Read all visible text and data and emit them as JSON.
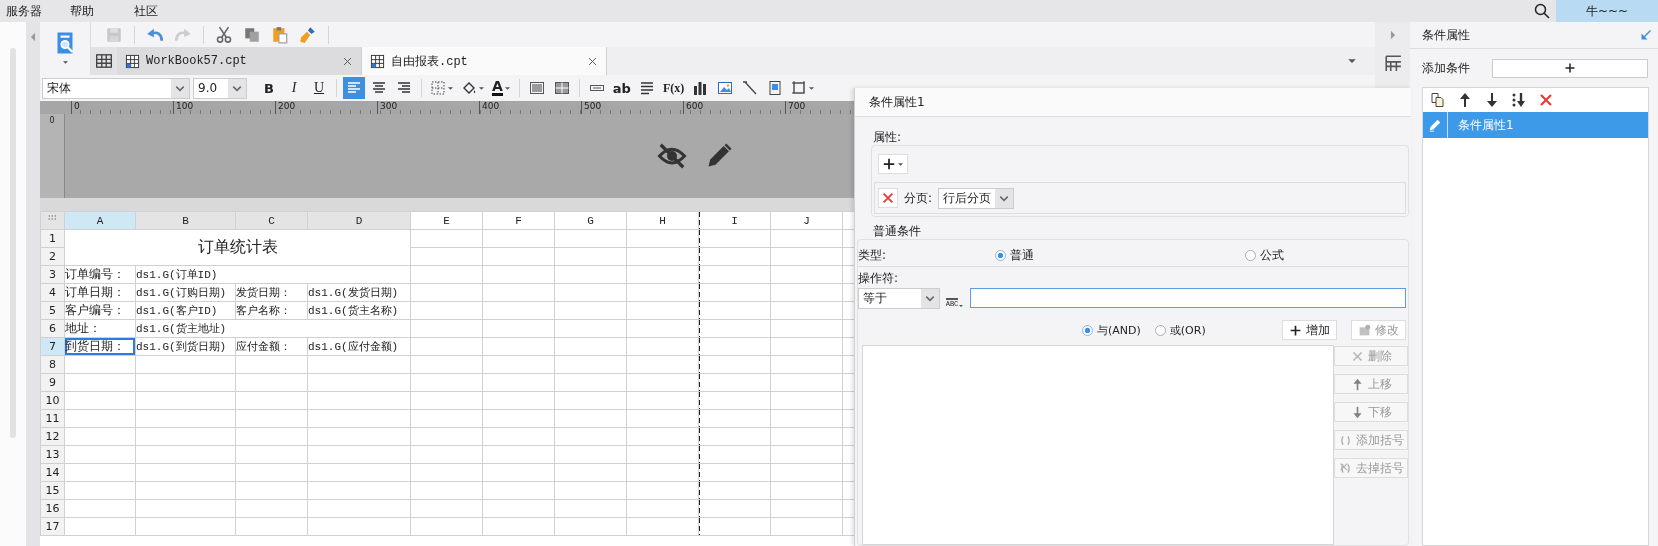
{
  "menu": [
    "服务器",
    "帮助",
    "社区"
  ],
  "account": {
    "name": "牛~~~"
  },
  "toolbar": [
    {
      "kind": "floppy-disk",
      "disabled": true
    },
    {
      "kind": "undo",
      "disabled": false
    },
    {
      "kind": "redo",
      "disabled": true
    },
    {
      "kind": "scissors",
      "disabled": false
    },
    {
      "kind": "copy",
      "disabled": false
    },
    {
      "kind": "paste",
      "disabled": false
    },
    {
      "kind": "brush",
      "disabled": false
    }
  ],
  "tabs": [
    {
      "label": "WorkBook57.cpt",
      "selected": false
    },
    {
      "label": "自由报表.cpt",
      "selected": true
    }
  ],
  "format_bar": {
    "font": "宋体",
    "size": "9.0",
    "tools": [
      {
        "kind": "bold",
        "label": "B",
        "selected": false
      },
      {
        "kind": "italic",
        "label": "I",
        "selected": false
      },
      {
        "kind": "underline",
        "label": "U",
        "selected": false
      },
      {
        "kind": "align-left",
        "selected": true
      },
      {
        "kind": "align-center",
        "selected": false
      },
      {
        "kind": "align-right",
        "selected": false
      },
      {
        "kind": "borders",
        "selected": false,
        "menu": true
      },
      {
        "kind": "bucket",
        "selected": false,
        "menu": true
      },
      {
        "kind": "font-color",
        "label": "A",
        "selected": false,
        "menu": true
      },
      {
        "kind": "merge",
        "selected": false
      },
      {
        "kind": "split",
        "selected": false
      },
      {
        "kind": "text-field",
        "selected": false
      },
      {
        "kind": "text",
        "label": "ab",
        "selected": false
      },
      {
        "kind": "paragraph",
        "selected": false
      },
      {
        "kind": "formula",
        "label": "F(x)",
        "selected": false
      },
      {
        "kind": "bar-chart",
        "selected": false
      },
      {
        "kind": "image",
        "selected": false
      },
      {
        "kind": "diagonal",
        "selected": false
      },
      {
        "kind": "page",
        "selected": false
      },
      {
        "kind": "frame",
        "selected": false,
        "menu": true
      }
    ]
  },
  "ruler": {
    "labels": [
      "0",
      "100",
      "200",
      "300",
      "400",
      "500",
      "600",
      "700"
    ],
    "vertical_label": "0"
  },
  "sheet": {
    "title": "订单统计表",
    "columns": [
      {
        "label": "A",
        "selected": true,
        "page_break": false
      },
      {
        "label": "B",
        "selected": false,
        "page_break": false
      },
      {
        "label": "C",
        "selected": false,
        "page_break": false
      },
      {
        "label": "D",
        "selected": false,
        "page_break": false
      },
      {
        "label": "E",
        "selected": false,
        "page_break": false
      },
      {
        "label": "F",
        "selected": false,
        "page_break": false
      },
      {
        "label": "G",
        "selected": false,
        "page_break": false
      },
      {
        "label": "H",
        "selected": false,
        "page_break": false
      },
      {
        "label": "I",
        "selected": false,
        "page_break": true
      },
      {
        "label": "J",
        "selected": false,
        "page_break": false
      }
    ],
    "rows": [
      {
        "label": "1",
        "selected": false,
        "cells": []
      },
      {
        "label": "2",
        "selected": false,
        "cells": []
      },
      {
        "label": "3",
        "selected": false,
        "cells": [
          {
            "text": "订单编号：",
            "selected": false
          },
          {
            "text": "ds1.G(订单ID)",
            "selected": false,
            "colspan": 3
          }
        ]
      },
      {
        "label": "4",
        "selected": false,
        "cells": [
          {
            "text": "订单日期：",
            "selected": false
          },
          {
            "text": "ds1.G(订购日期)",
            "selected": false
          },
          {
            "text": "发货日期：",
            "selected": false
          },
          {
            "text": "ds1.G(发货日期)",
            "selected": false
          }
        ]
      },
      {
        "label": "5",
        "selected": false,
        "cells": [
          {
            "text": "客户编号：",
            "selected": false
          },
          {
            "text": "ds1.G(客户ID)",
            "selected": false
          },
          {
            "text": "客户名称：",
            "selected": false
          },
          {
            "text": "ds1.G(货主名称)",
            "selected": false
          }
        ]
      },
      {
        "label": "6",
        "selected": false,
        "cells": [
          {
            "text": "地址：",
            "selected": false
          },
          {
            "text": "ds1.G(货主地址)",
            "selected": false,
            "colspan": 3
          }
        ]
      },
      {
        "label": "7",
        "selected": true,
        "cells": [
          {
            "text": "到货日期：",
            "selected": true
          },
          {
            "text": "ds1.G(到货日期)",
            "selected": false
          },
          {
            "text": "应付金额：",
            "selected": false
          },
          {
            "text": "ds1.G(应付金额)",
            "selected": false
          }
        ]
      },
      {
        "label": "8",
        "selected": false,
        "cells": []
      },
      {
        "label": "9",
        "selected": false,
        "cells": []
      },
      {
        "label": "10",
        "selected": false,
        "cells": []
      },
      {
        "label": "11",
        "selected": false,
        "cells": []
      },
      {
        "label": "12",
        "selected": false,
        "cells": []
      },
      {
        "label": "13",
        "selected": false,
        "cells": []
      },
      {
        "label": "14",
        "selected": false,
        "cells": []
      },
      {
        "label": "15",
        "selected": false,
        "cells": []
      },
      {
        "label": "16",
        "selected": false,
        "cells": []
      },
      {
        "label": "17",
        "selected": false,
        "cells": []
      }
    ]
  },
  "dialog": {
    "title": "条件属性1",
    "properties": {
      "label": "属性:",
      "rows": [
        {
          "label": "分页:",
          "value": "行后分页"
        }
      ]
    },
    "condition": {
      "label": "普通条件",
      "type_label": "类型:",
      "types": [
        {
          "label": "普通",
          "selected": true
        },
        {
          "label": "公式",
          "selected": false
        }
      ],
      "operator_label": "操作符:",
      "operator": "等于",
      "value_type": "ABC",
      "joins": [
        {
          "label": "与(AND)",
          "selected": true
        },
        {
          "label": "或(OR)",
          "selected": false
        }
      ],
      "actions": [
        {
          "kind": "plus",
          "label": "增加",
          "disabled": false
        },
        {
          "kind": "gear",
          "label": "修改",
          "disabled": true
        }
      ],
      "list_actions": [
        {
          "kind": "cross",
          "label": "删除",
          "disabled": true
        },
        {
          "kind": "arrow-up",
          "label": "上移",
          "disabled": true
        },
        {
          "kind": "arrow-down",
          "label": "下移",
          "disabled": true
        },
        {
          "kind": "parens",
          "label": "添加括号",
          "disabled": true
        },
        {
          "kind": "parens-cross",
          "label": "去掉括号",
          "disabled": true
        }
      ]
    }
  },
  "panel": {
    "title": "条件属性",
    "add_label": "添加条件",
    "tools": [
      {
        "kind": "copy-doc"
      },
      {
        "kind": "arrow-up"
      },
      {
        "kind": "arrow-down"
      },
      {
        "kind": "move-bottom"
      },
      {
        "kind": "delete-cross"
      }
    ],
    "items": [
      {
        "label": "条件属性1",
        "selected": true
      }
    ]
  }
}
